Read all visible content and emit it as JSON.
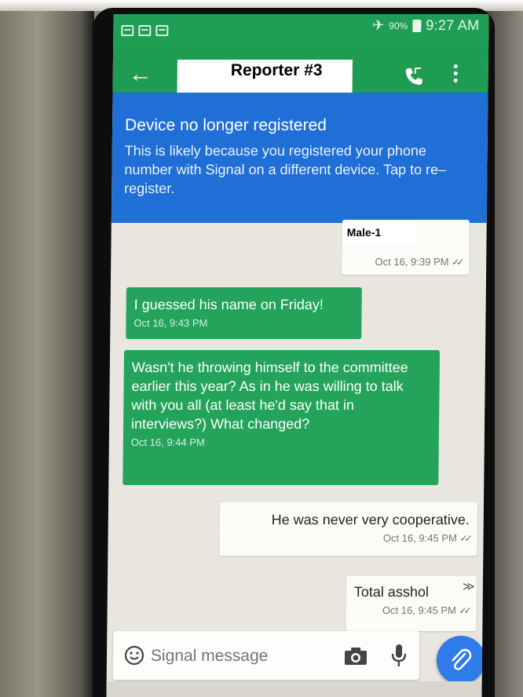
{
  "status_bar": {
    "battery": "90%",
    "time": "9:27 AM"
  },
  "header": {
    "title": "Reporter #3"
  },
  "banner": {
    "title": "Device no longer registered",
    "text": "This is likely because you registered your phone number with Signal on a different device. Tap to re–register."
  },
  "messages": [
    {
      "direction": "out",
      "sender_label": "Male-1",
      "text": "",
      "time": "Oct 16, 9:39 PM"
    },
    {
      "direction": "in",
      "text": "I guessed his name on Friday!",
      "time": "Oct 16, 9:43 PM"
    },
    {
      "direction": "in",
      "text": "Wasn't he throwing himself to the committee earlier this year? As in he was willing to talk with you all (at least he'd say that in interviews?) What changed?",
      "time": "Oct 16, 9:44 PM"
    },
    {
      "direction": "out",
      "text": "He was never very cooperative.",
      "time": "Oct 16, 9:45 PM"
    },
    {
      "direction": "out",
      "text": "Total asshol",
      "time": "Oct 16, 9:45 PM"
    }
  ],
  "composer": {
    "placeholder": "Signal message"
  },
  "icons": {
    "back": "arrow-left-icon",
    "call": "phone-call-icon",
    "more": "more-vertical-icon",
    "emoji": "smiley-icon",
    "camera": "camera-icon",
    "mic": "microphone-icon",
    "attach": "paperclip-icon"
  },
  "colors": {
    "app_bar": "#1e9c52",
    "banner": "#1f6fd6",
    "incoming_bubble": "#24a45b",
    "attach_button": "#2f7be8"
  }
}
